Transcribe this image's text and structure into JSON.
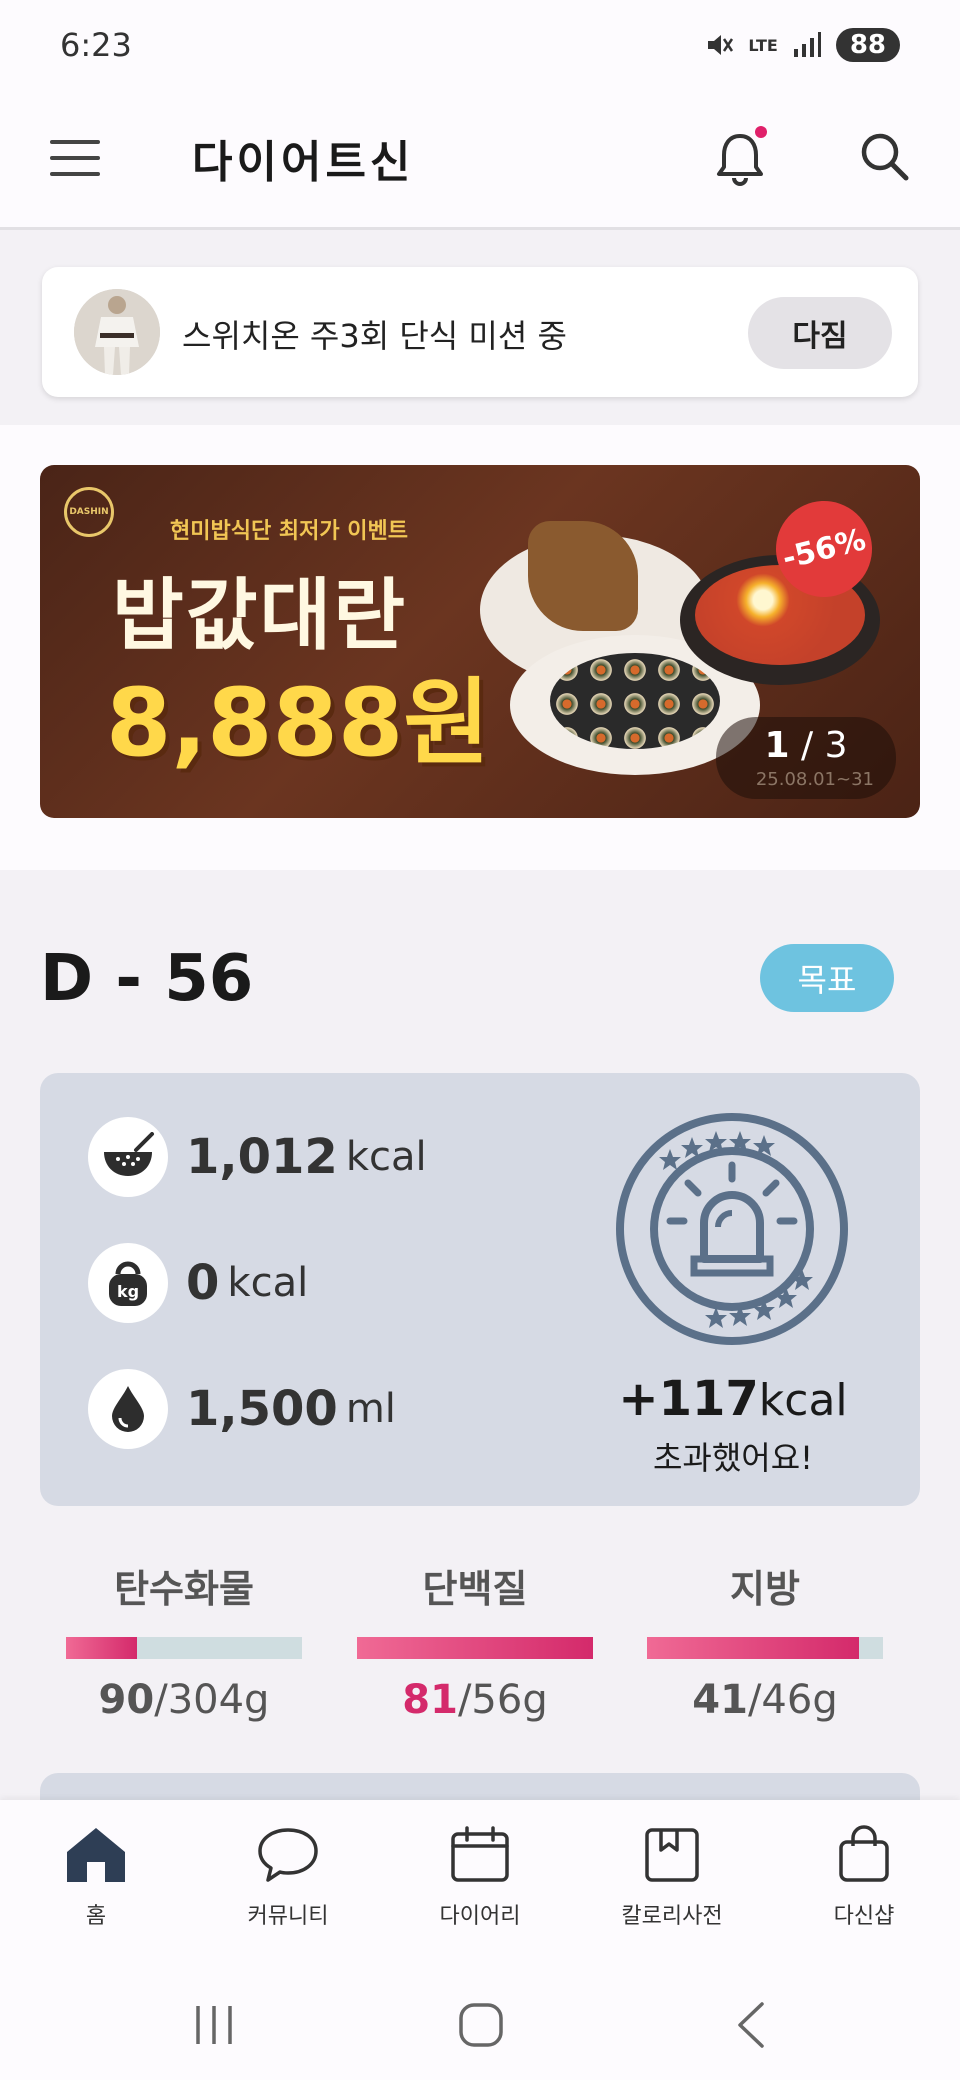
{
  "status_bar": {
    "time": "6:23",
    "network": "LTE",
    "battery": "88"
  },
  "header": {
    "title": "다이어트신"
  },
  "mission": {
    "text": "스위치온 주3회 단식 미션 중",
    "button": "다짐"
  },
  "banner": {
    "brand": "DASHIN",
    "subtitle": "현미밥식단 최저가 이벤트",
    "title": "밥값대란",
    "price": "8,888원",
    "discount": "-56%",
    "pager_current": "1",
    "pager_sep": " / ",
    "pager_total": "3",
    "date": "25.08.01~31"
  },
  "dday": {
    "label": "D - 56",
    "goal_button": "목표"
  },
  "summary": {
    "intake": {
      "value": "1,012",
      "unit": "kcal"
    },
    "burned": {
      "value": "0",
      "unit": "kcal"
    },
    "water": {
      "value": "1,500",
      "unit": "ml"
    },
    "excess_value": "+117",
    "excess_unit": "kcal",
    "excess_label": "초과했어요!"
  },
  "macros": [
    {
      "label": "탄수화물",
      "current": "90",
      "target": "/304g",
      "progress": 0.3,
      "over": false
    },
    {
      "label": "단백질",
      "current": "81",
      "target": "/56g",
      "progress": 1.0,
      "over": true
    },
    {
      "label": "지방",
      "current": "41",
      "target": "/46g",
      "progress": 0.9,
      "over": false
    }
  ],
  "nav": [
    {
      "label": "홈",
      "icon": "home-icon"
    },
    {
      "label": "커뮤니티",
      "icon": "chat-icon"
    },
    {
      "label": "다이어리",
      "icon": "calendar-icon"
    },
    {
      "label": "칼로리사전",
      "icon": "book-icon"
    },
    {
      "label": "다신샵",
      "icon": "shopping-bag-icon"
    }
  ],
  "colors": {
    "accent_pink": "#d42a6b",
    "goal_blue": "#6ec3e0",
    "card_gray": "#d6dae4"
  }
}
